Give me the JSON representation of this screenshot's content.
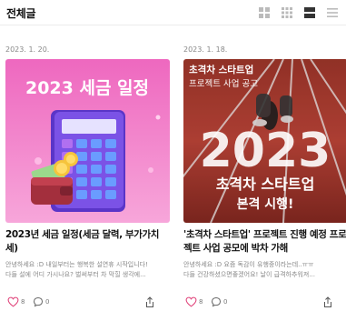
{
  "header": {
    "title": "전체글",
    "view_icons": [
      "grid-large-icon",
      "grid-small-icon",
      "list-card-icon",
      "list-compact-icon"
    ]
  },
  "posts": [
    {
      "date": "2023. 1. 20.",
      "thumbnail": {
        "headline": "2023 세금 일정",
        "colors": {
          "bg_top": "#f06fc2",
          "bg_bottom": "#f7a0d8",
          "calculator": "#6a44d8",
          "wallet": "#a8323f",
          "coin": "#f5c43c"
        }
      },
      "title": "2023년 세금 일정(세금 달력, 부가가치세)",
      "excerpt": [
        "안녕하세요 :D 내일부터는 행복한 설연휴 시작입니다!",
        "다들 설에 어디 가시나요? 벌써부터 차 막힐 생각에..."
      ],
      "likes": "8",
      "comments": "0"
    },
    {
      "date": "2023. 1. 18.",
      "thumbnail": {
        "overlay_line1": "초격차 스타트업",
        "overlay_line2": "프로젝트 사업 공고",
        "big_year": "2023",
        "headline_line1": "초격차 스타트업",
        "headline_line2": "본격 시행!",
        "colors": {
          "track": "#c0392b",
          "lane": "#ffffff"
        }
      },
      "title": "'초격차 스타트업' 프로젝트 진행 예정 프로젝트 사업 공모에 박차 가해",
      "excerpt": [
        "안녕하세요 :D 요즘 독감이 유행중이라는데..ㅠㅠ",
        "다들 건강하셨으면좋겠어요! 날이 급격하추워져..."
      ],
      "likes": "8",
      "comments": "0"
    }
  ]
}
